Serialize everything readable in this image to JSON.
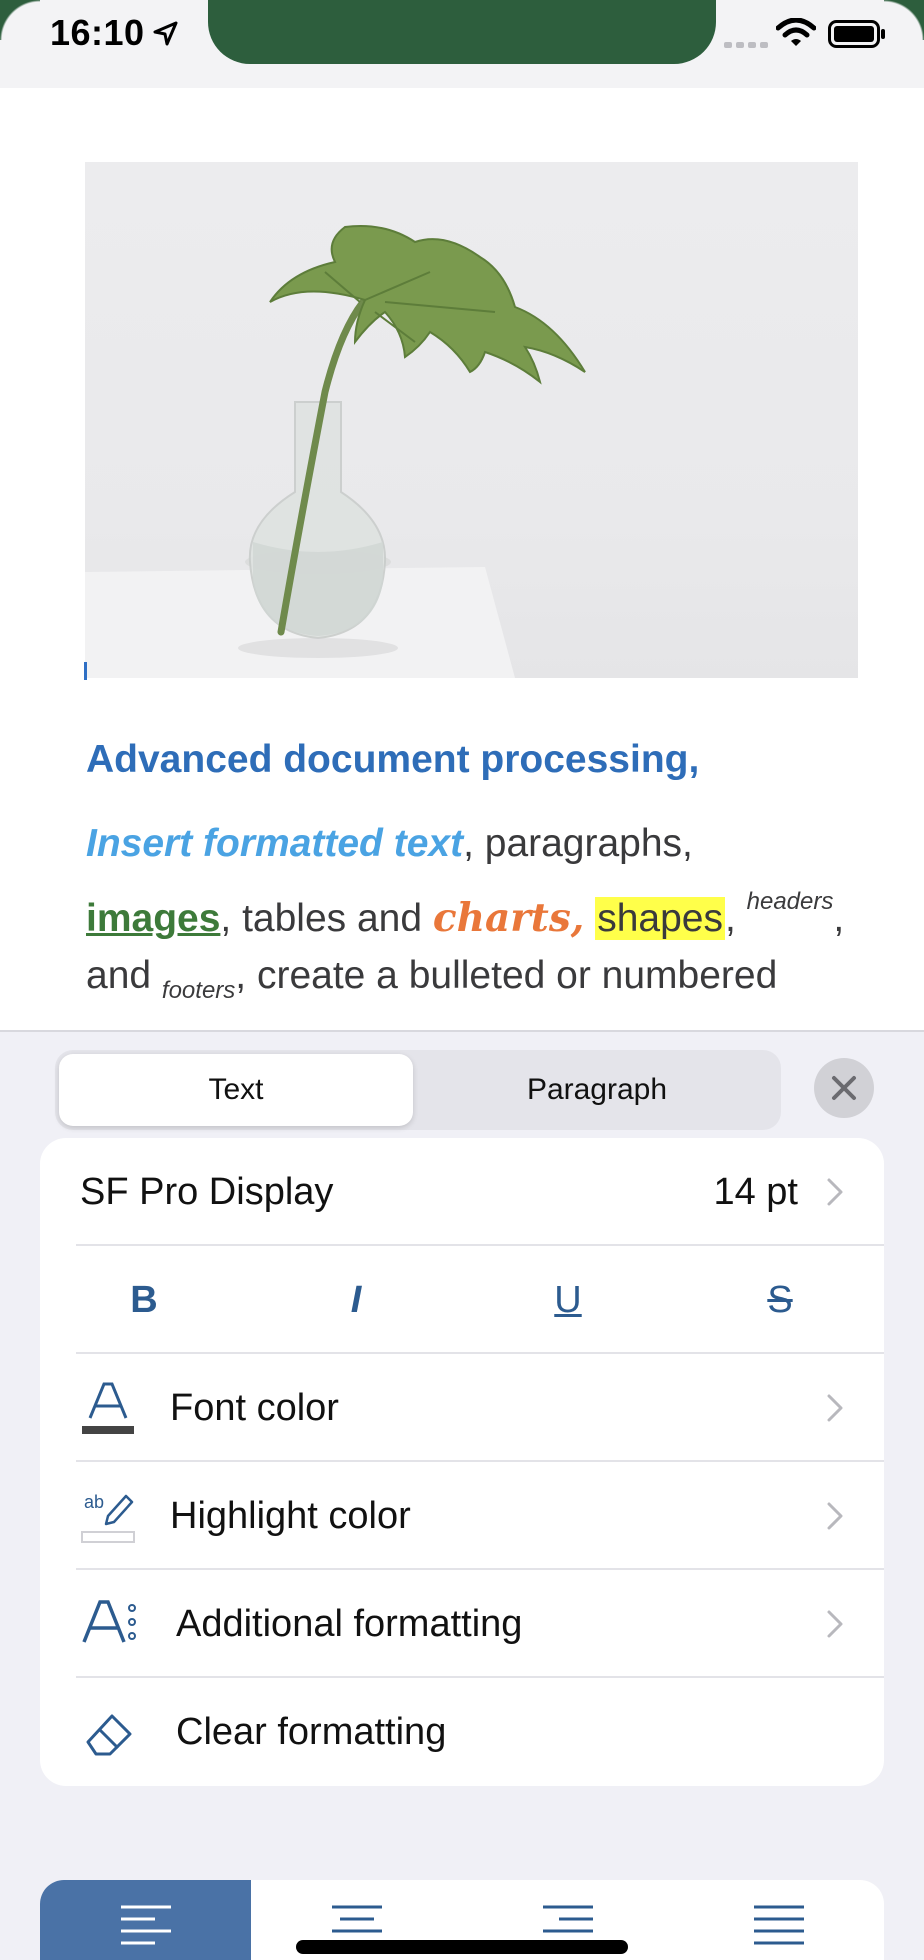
{
  "status_bar": {
    "time": "16:10"
  },
  "document": {
    "image_alt": "plant in glass vase",
    "heading": "Advanced document processing,",
    "line1": {
      "insert": "Insert formatted text",
      "after_insert": ",  paragraphs,"
    },
    "line2": {
      "images": "images",
      "after_images": ", tables and ",
      "charts": "charts,",
      "space": " ",
      "shapes": "shapes",
      "comma": ", ",
      "headers": "headers",
      "end": ","
    },
    "line3": {
      "and": "and ",
      "footers": "footers",
      "rest": ", create a bulleted or numbered"
    }
  },
  "panel": {
    "tabs": {
      "text": "Text",
      "paragraph": "Paragraph"
    },
    "font": {
      "name": "SF Pro Display",
      "size": "14 pt"
    },
    "styles": {
      "bold": "B",
      "italic": "I",
      "underline": "U",
      "strikethrough": "S"
    },
    "rows": {
      "font_color": "Font color",
      "highlight_color": "Highlight color",
      "additional_formatting": "Additional formatting",
      "clear_formatting": "Clear formatting"
    },
    "colors": {
      "accent": "#4a72a6",
      "heading_blue": "#2e6db8",
      "highlight_yellow": "#ffff4a"
    }
  }
}
